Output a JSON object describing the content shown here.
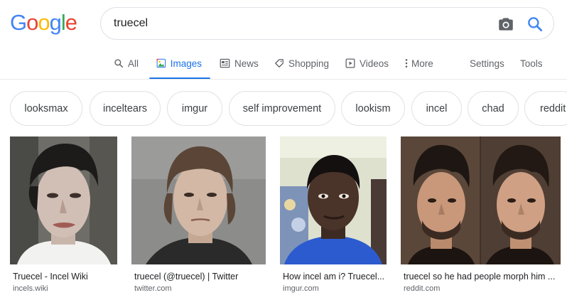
{
  "logo": {
    "letters": [
      "G",
      "o",
      "o",
      "g",
      "l",
      "e"
    ],
    "colors": [
      "#4285F4",
      "#EA4335",
      "#FBBC05",
      "#4285F4",
      "#34A853",
      "#EA4335"
    ]
  },
  "search": {
    "query": "truecel",
    "camera_icon": "camera-icon",
    "search_icon": "magnifier-icon"
  },
  "tabs": {
    "all": "All",
    "images": "Images",
    "news": "News",
    "shopping": "Shopping",
    "videos": "Videos",
    "more": "More",
    "settings": "Settings",
    "tools": "Tools"
  },
  "chips": [
    "looksmax",
    "inceltears",
    "imgur",
    "self improvement",
    "lookism",
    "incel",
    "chad",
    "reddit"
  ],
  "results": [
    {
      "caption": "Truecel - Incel Wiki",
      "source": "incels.wiki"
    },
    {
      "caption": "truecel (@truecel) | Twitter",
      "source": "twitter.com"
    },
    {
      "caption": "How incel am i? Truecel...",
      "source": "imgur.com"
    },
    {
      "caption": "truecel so he had people morph him ...",
      "source": "reddit.com"
    }
  ],
  "colors": {
    "accent": "#1a73e8",
    "tab_text": "#5f6368",
    "chip_border": "#dfe1e5"
  }
}
